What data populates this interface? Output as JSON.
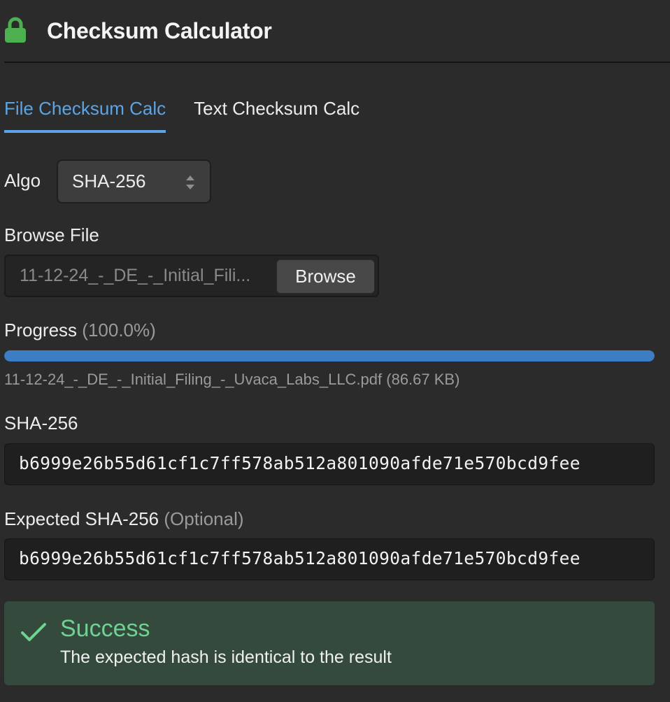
{
  "header": {
    "title": "Checksum Calculator",
    "icon": "lock-icon"
  },
  "tabs": [
    {
      "label": "File Checksum Calc",
      "active": true
    },
    {
      "label": "Text Checksum Calc",
      "active": false
    }
  ],
  "algo": {
    "label": "Algo",
    "selected": "SHA-256"
  },
  "browse": {
    "label": "Browse File",
    "file_value": "11-12-24_-_DE_-_Initial_Fili...",
    "button_label": "Browse"
  },
  "progress": {
    "label": "Progress",
    "percent_text": "(100.0%)",
    "value": 1.0,
    "file_info": "11-12-24_-_DE_-_Initial_Filing_-_Uvaca_Labs_LLC.pdf (86.67 KB)"
  },
  "result": {
    "label": "SHA-256",
    "hash": "b6999e26b55d61cf1c7ff578ab512a801090afde71e570bcd9fee"
  },
  "expected": {
    "label": "Expected SHA-256",
    "optional": "(Optional)",
    "hash": "b6999e26b55d61cf1c7ff578ab512a801090afde71e570bcd9fee"
  },
  "alert": {
    "title": "Success",
    "message": "The expected hash is identical to the result"
  },
  "colors": {
    "accent": "#5ba4e6",
    "progress": "#3c7dc4",
    "success": "#6fd293",
    "success_bg": "#344a3d",
    "lock": "#4caf50"
  }
}
